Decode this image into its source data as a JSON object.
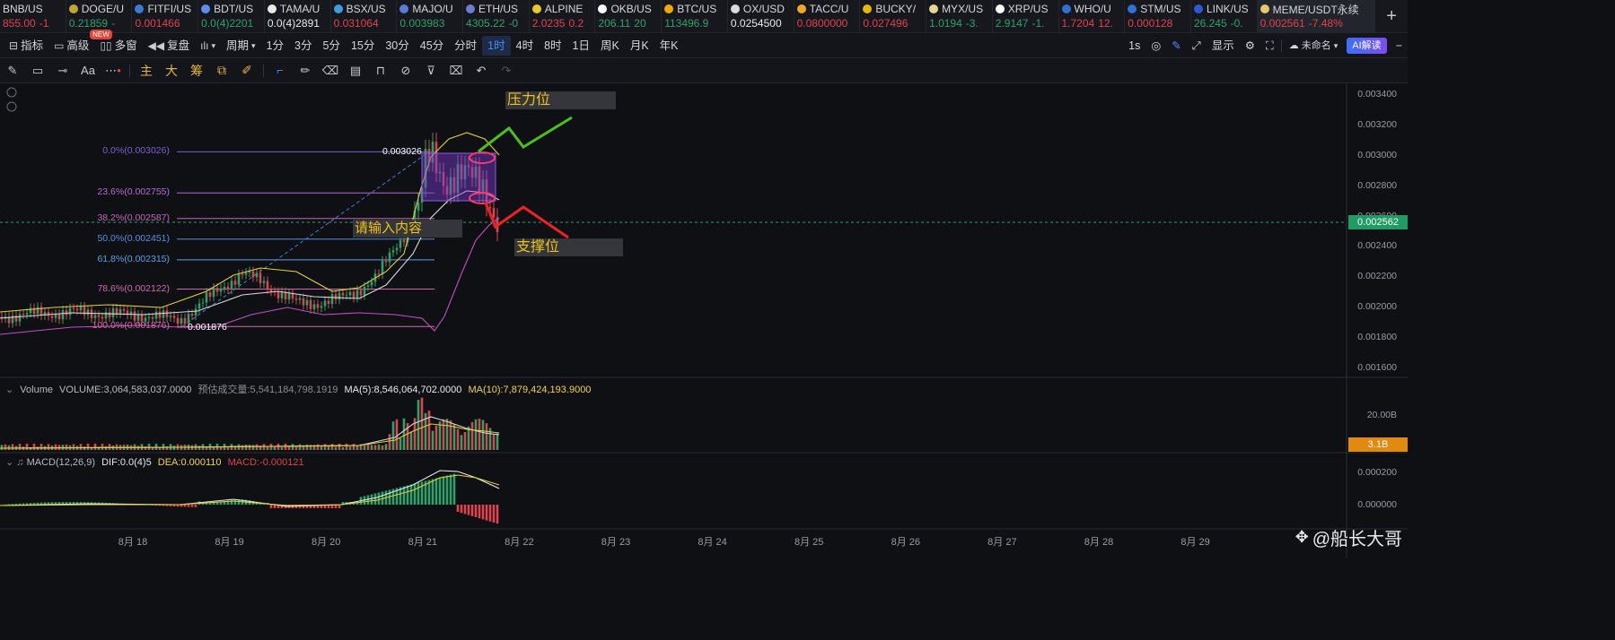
{
  "tickers": [
    {
      "symbol": "BNB/US",
      "price": "855.00",
      "change": "-1",
      "coin_color": "#f0b90b",
      "dir": "down"
    },
    {
      "symbol": "DOGE/U",
      "price": "0.21859",
      "change": "-",
      "coin_color": "#c2a633",
      "dir": "up"
    },
    {
      "symbol": "FITFI/US",
      "price": "0.001466",
      "change": "",
      "coin_color": "#3a7bd5",
      "dir": "down"
    },
    {
      "symbol": "BDT/US",
      "price": "0.0(4)2201",
      "change": "",
      "coin_color": "#5a8dee",
      "dir": "up"
    },
    {
      "symbol": "TAMA/U",
      "price": "0.0(4)2891",
      "change": "",
      "coin_color": "#e8e8e8",
      "dir": "neutral"
    },
    {
      "symbol": "BSX/US",
      "price": "0.031064",
      "change": "",
      "coin_color": "#3c9ee0",
      "dir": "down"
    },
    {
      "symbol": "MAJO/U",
      "price": "0.003983",
      "change": "",
      "coin_color": "#5b7bd8",
      "dir": "up"
    },
    {
      "symbol": "ETH/US",
      "price": "4305.22",
      "change": "-0",
      "coin_color": "#6a7ecf",
      "dir": "up"
    },
    {
      "symbol": "ALPINE",
      "price": "2.0235",
      "change": "0.2",
      "coin_color": "#e8c82a",
      "dir": "down"
    },
    {
      "symbol": "OKB/US",
      "price": "206.11",
      "change": "20",
      "coin_color": "#ffffff",
      "dir": "up"
    },
    {
      "symbol": "BTC/US",
      "price": "113496.9",
      "change": "",
      "coin_color": "#f2a900",
      "dir": "up"
    },
    {
      "symbol": "OX/USD",
      "price": "0.0254500",
      "change": "",
      "coin_color": "#dadada",
      "dir": "neutral"
    },
    {
      "symbol": "TACC/U",
      "price": "0.0800000",
      "change": "",
      "coin_color": "#f5a623",
      "dir": "down"
    },
    {
      "symbol": "BUCKY/",
      "price": "0.027496",
      "change": "",
      "coin_color": "#e6b800",
      "dir": "down"
    },
    {
      "symbol": "MYX/US",
      "price": "1.0194",
      "change": "-3.",
      "coin_color": "#e9d596",
      "dir": "up"
    },
    {
      "symbol": "XRP/US",
      "price": "2.9147",
      "change": "-1.",
      "coin_color": "#ffffff",
      "dir": "up"
    },
    {
      "symbol": "WHO/U",
      "price": "1.7204",
      "change": "12.",
      "coin_color": "#2f6fd6",
      "dir": "down"
    },
    {
      "symbol": "STM/US",
      "price": "0.000128",
      "change": "",
      "coin_color": "#2f6fd6",
      "dir": "down"
    },
    {
      "symbol": "LINK/US",
      "price": "26.245",
      "change": "-0.",
      "coin_color": "#2a5ada",
      "dir": "up"
    },
    {
      "symbol": "MEME/USDT永续",
      "price": "0.002561",
      "change": "-7.48%",
      "coin_color": "#e6c76a",
      "dir": "down"
    }
  ],
  "colors": {
    "up": "#2aa26a",
    "down": "#e0424e",
    "neutral": "#e8e9ec",
    "accent": "#4b8bff",
    "annotation": "#f1c40f"
  },
  "toolbar": {
    "indicator": "指标",
    "advanced": "高级",
    "new_badge": "NEW",
    "multi_window": "多窗",
    "replay": "复盘",
    "chart_type": "",
    "period": "周期",
    "intervals": [
      "1分",
      "3分",
      "5分",
      "15分",
      "30分",
      "45分",
      "分时",
      "1时",
      "4时",
      "8时",
      "1日",
      "周K",
      "月K",
      "年K"
    ],
    "selected_interval": "1时",
    "refresh": "1s",
    "display": "显示",
    "layout_name": "未命名",
    "ai_button": "AI解读"
  },
  "draw_tools": {
    "main": "主",
    "big": "大",
    "chips": "筹"
  },
  "price_axis": [
    "0.003400",
    "0.003200",
    "0.003000",
    "0.002800",
    "0.002600",
    "0.002400",
    "0.002200",
    "0.002000",
    "0.001800",
    "0.001600"
  ],
  "current_price_tag": "0.002562",
  "date_axis": [
    "8月 18",
    "8月 19",
    "8月 20",
    "8月 21",
    "8月 22",
    "8月 23",
    "8月 24",
    "8月 25",
    "8月 26",
    "8月 27",
    "8月 28",
    "8月 29"
  ],
  "fib_levels": [
    {
      "label": "0.0%(0.003026)",
      "price": 0.003026,
      "color": "#7d5fd1"
    },
    {
      "label": "23.6%(0.002755)",
      "price": 0.002755,
      "color": "#b46ad6"
    },
    {
      "label": "38.2%(0.002587)",
      "price": 0.002587,
      "color": "#c365b8"
    },
    {
      "label": "50.0%(0.002451)",
      "price": 0.002451,
      "color": "#5a8fe0"
    },
    {
      "label": "61.8%(0.002315)",
      "price": 0.002315,
      "color": "#5aa0e0"
    },
    {
      "label": "78.6%(0.002122)",
      "price": 0.002122,
      "color": "#d06ab0"
    },
    {
      "label": "100.0%(0.001876)",
      "price": 0.001876,
      "color": "#d46aa6"
    }
  ],
  "high_marker": "0.003026",
  "low_marker": "0.001876",
  "annotations": {
    "resistance": "压力位",
    "support": "支撑位",
    "text_prompt": "请输入内容"
  },
  "volume_pane": {
    "title": "Volume",
    "volume": "VOLUME:3,064,583,037.0000",
    "estimated": "预估成交量:5,541,184,798.1919",
    "ma5": "MA(5):8,546,064,702.0000",
    "ma10": "MA(10):7,879,424,193.9000",
    "axis_label": "20.00B",
    "tag": "3.1B"
  },
  "macd_pane": {
    "title": "MACD(12,26,9)",
    "dif": "DIF:0.0(4)5",
    "dea": "DEA:0.000110",
    "macd": "MACD:-0.000121",
    "axis_top": "0.000200",
    "axis_zero": "0.000000"
  },
  "watermark": "@船长大哥"
}
